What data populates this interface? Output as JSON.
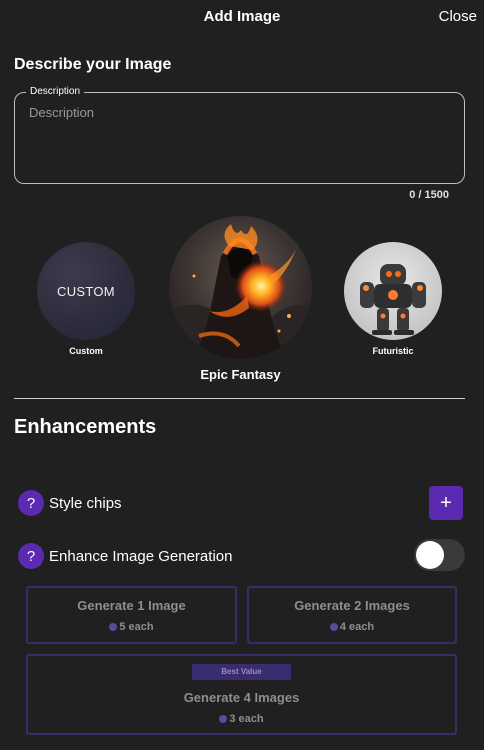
{
  "header": {
    "title": "Add Image",
    "close_label": "Close"
  },
  "describe": {
    "heading": "Describe your Image",
    "field_label": "Description",
    "placeholder": "Description",
    "value": "",
    "char_count": "0 / 1500"
  },
  "styles": {
    "items": [
      {
        "circle_text": "CUSTOM",
        "caption": "Custom"
      },
      {
        "caption": "Epic Fantasy",
        "selected": true
      },
      {
        "caption": "Futuristic"
      }
    ]
  },
  "enhancements": {
    "heading": "Enhancements",
    "style_chips_label": "Style chips",
    "enhance_label": "Enhance Image Generation",
    "enhance_enabled": false,
    "help_icon_glyph": "?",
    "plus_glyph": "+"
  },
  "generate": {
    "options": [
      {
        "title": "Generate 1 Image",
        "cost": "5 each"
      },
      {
        "title": "Generate 2 Images",
        "cost": "4 each"
      },
      {
        "title": "Generate 4 Images",
        "cost": "3 each",
        "badge": "Best Value"
      }
    ]
  },
  "colors": {
    "background": "#202020",
    "accent": "#5a2ab0",
    "button_border": "#3c2a6a",
    "muted_text": "#8e8e8e"
  }
}
